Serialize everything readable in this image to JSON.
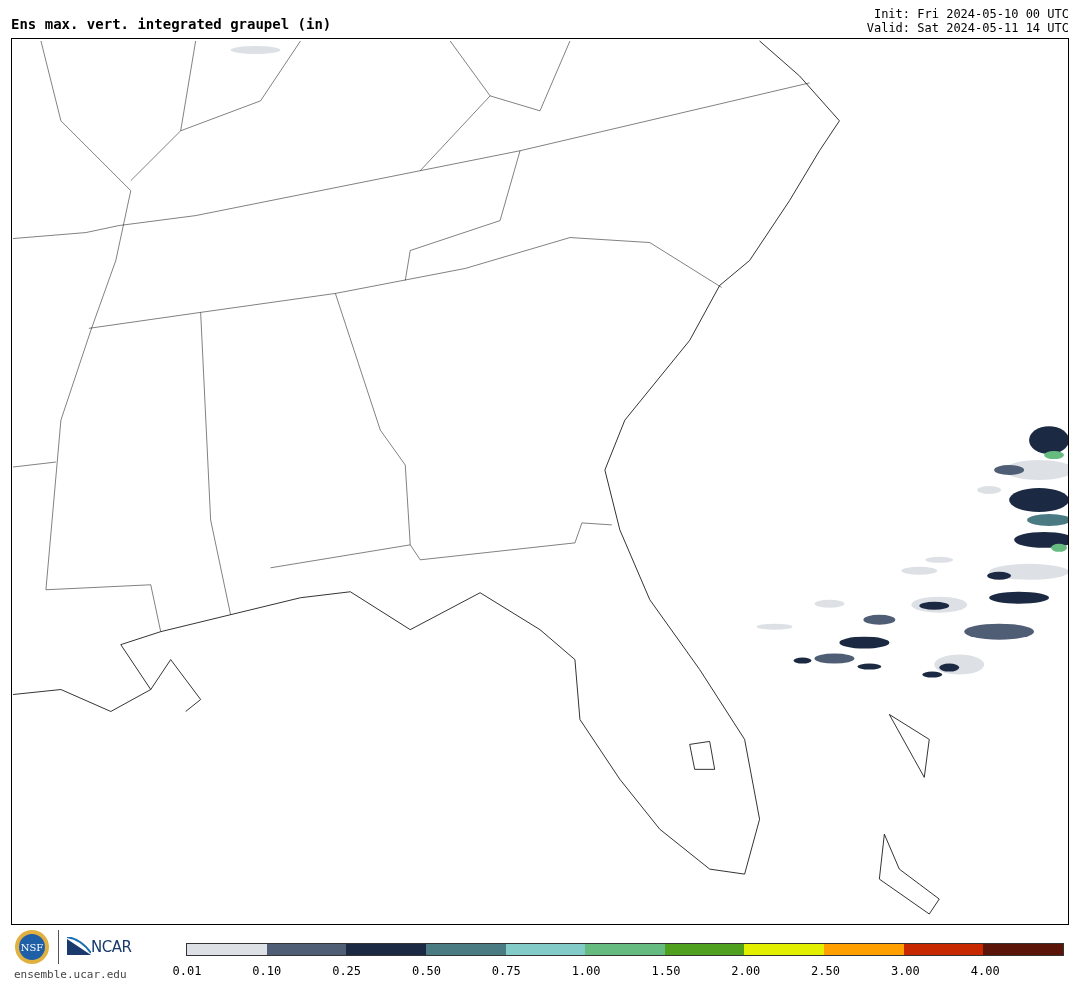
{
  "title": "Ens max. vert. integrated graupel (in)",
  "init": "Init: Fri 2024-05-10 00 UTC",
  "valid": "Valid: Sat 2024-05-11 14 UTC",
  "logos": {
    "nsf": "NSF",
    "ncar": "NCAR",
    "url": "ensemble.ucar.edu"
  },
  "colorbar": [
    {
      "label": "0.01",
      "color": "#dde1e6"
    },
    {
      "label": "0.10",
      "color": "#4f5e75"
    },
    {
      "label": "0.25",
      "color": "#1b2a42"
    },
    {
      "label": "0.50",
      "color": "#4a7b82"
    },
    {
      "label": "0.75",
      "color": "#82cbc8"
    },
    {
      "label": "1.00",
      "color": "#65bb80"
    },
    {
      "label": "1.50",
      "color": "#50a020"
    },
    {
      "label": "2.00",
      "color": "#e2f000"
    },
    {
      "label": "2.50",
      "color": "#ffa000"
    },
    {
      "label": "3.00",
      "color": "#c82800"
    },
    {
      "label": "4.00",
      "color": "#5a1408"
    }
  ]
}
